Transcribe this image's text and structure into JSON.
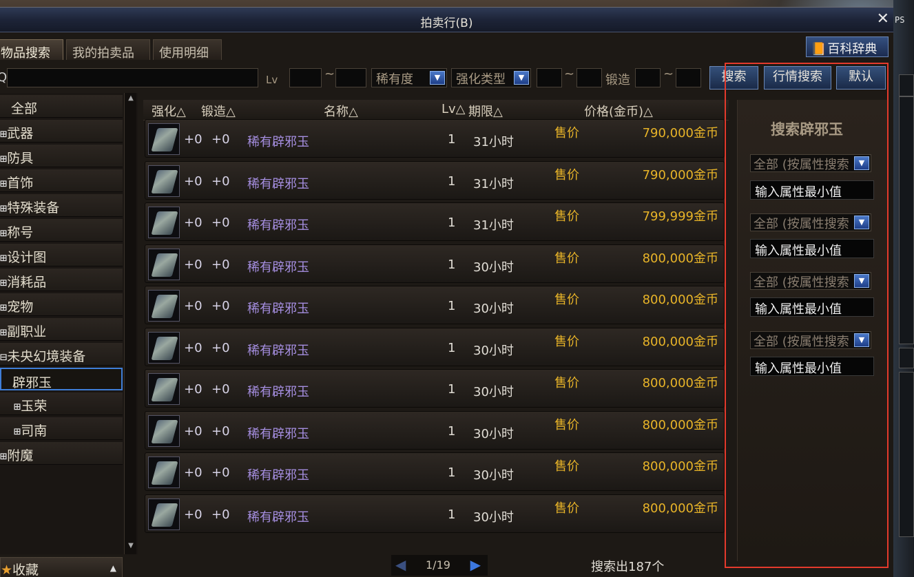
{
  "window": {
    "title": "拍卖行(B)",
    "close": "✕"
  },
  "tabs": [
    {
      "label": "物品搜索",
      "active": true
    },
    {
      "label": "我的拍卖品",
      "active": false
    },
    {
      "label": "使用明细",
      "active": false
    }
  ],
  "wiki_button": {
    "label": "百科辞典",
    "icon": "book-icon"
  },
  "search": {
    "prefix": "Q",
    "keyword": "",
    "lv_label": "Lv",
    "lv_sep": "~",
    "rarity": "稀有度",
    "enhance_type": "强化类型",
    "enhance_sep": "~",
    "forge_label": "锻造",
    "forge_sep": "~",
    "btn_search": "搜索",
    "btn_market": "行情搜索",
    "btn_default": "默认"
  },
  "categories": [
    {
      "label": "全部",
      "exp": ""
    },
    {
      "label": "武器",
      "exp": "⊞"
    },
    {
      "label": "防具",
      "exp": "⊞"
    },
    {
      "label": "首饰",
      "exp": "⊞"
    },
    {
      "label": "特殊装备",
      "exp": "⊞"
    },
    {
      "label": "称号",
      "exp": "⊞"
    },
    {
      "label": "设计图",
      "exp": "⊞"
    },
    {
      "label": "消耗品",
      "exp": "⊞"
    },
    {
      "label": "宠物",
      "exp": "⊞"
    },
    {
      "label": "副职业",
      "exp": "⊞"
    },
    {
      "label": "未央幻境装备",
      "exp": "⊟"
    },
    {
      "label": "辟邪玉",
      "exp": "",
      "selected": true
    },
    {
      "label": "玉荣",
      "exp": "⊞",
      "sub": true
    },
    {
      "label": "司南",
      "exp": "⊞",
      "sub": true
    },
    {
      "label": "附魔",
      "exp": "⊞"
    }
  ],
  "favorites": {
    "label": "收藏"
  },
  "columns": {
    "enhance": "强化△",
    "forge": "锻造△",
    "name": "名称△",
    "lv": "Lv△",
    "expiry": "期限△",
    "price": "价格(金币)△"
  },
  "rows": [
    {
      "enhance": "+0",
      "forge": "+0",
      "name": "稀有辟邪玉",
      "lv": "1",
      "expiry": "31小时",
      "sell": "售价",
      "price": "790,000金币"
    },
    {
      "enhance": "+0",
      "forge": "+0",
      "name": "稀有辟邪玉",
      "lv": "1",
      "expiry": "31小时",
      "sell": "售价",
      "price": "790,000金币"
    },
    {
      "enhance": "+0",
      "forge": "+0",
      "name": "稀有辟邪玉",
      "lv": "1",
      "expiry": "31小时",
      "sell": "售价",
      "price": "799,999金币"
    },
    {
      "enhance": "+0",
      "forge": "+0",
      "name": "稀有辟邪玉",
      "lv": "1",
      "expiry": "30小时",
      "sell": "售价",
      "price": "800,000金币"
    },
    {
      "enhance": "+0",
      "forge": "+0",
      "name": "稀有辟邪玉",
      "lv": "1",
      "expiry": "30小时",
      "sell": "售价",
      "price": "800,000金币"
    },
    {
      "enhance": "+0",
      "forge": "+0",
      "name": "稀有辟邪玉",
      "lv": "1",
      "expiry": "30小时",
      "sell": "售价",
      "price": "800,000金币"
    },
    {
      "enhance": "+0",
      "forge": "+0",
      "name": "稀有辟邪玉",
      "lv": "1",
      "expiry": "30小时",
      "sell": "售价",
      "price": "800,000金币"
    },
    {
      "enhance": "+0",
      "forge": "+0",
      "name": "稀有辟邪玉",
      "lv": "1",
      "expiry": "30小时",
      "sell": "售价",
      "price": "800,000金币"
    },
    {
      "enhance": "+0",
      "forge": "+0",
      "name": "稀有辟邪玉",
      "lv": "1",
      "expiry": "30小时",
      "sell": "售价",
      "price": "800,000金币"
    },
    {
      "enhance": "+0",
      "forge": "+0",
      "name": "稀有辟邪玉",
      "lv": "1",
      "expiry": "30小时",
      "sell": "售价",
      "price": "800,000金币"
    }
  ],
  "pager": {
    "page": "1/19",
    "prev": "◀",
    "next": "▶"
  },
  "result_count": "搜索出187个",
  "attr_panel": {
    "title": "搜索辟邪玉",
    "filters": [
      {
        "dropdown": "全部 (按属性搜索",
        "input": "输入属性最小值"
      },
      {
        "dropdown": "全部 (按属性搜索",
        "input": "输入属性最小值"
      },
      {
        "dropdown": "全部 (按属性搜索",
        "input": "输入属性最小值"
      },
      {
        "dropdown": "全部 (按属性搜索",
        "input": "输入属性最小值"
      }
    ]
  },
  "right_strip": {
    "tag": "PS"
  },
  "colors": {
    "highlight": "#e43a2c",
    "price": "#e8b428",
    "item_name": "#a58ee0",
    "accent_blue": "#3f7ed8"
  }
}
